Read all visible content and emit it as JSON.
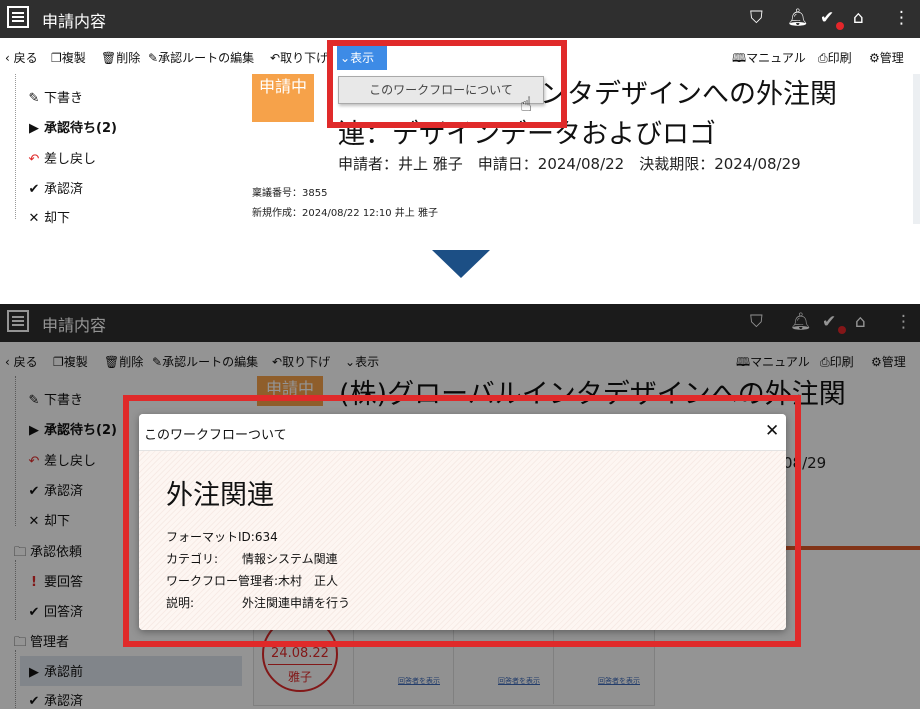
{
  "header": {
    "title": "申請内容",
    "icons": [
      "menu-icon",
      "beginner-mark-icon",
      "bell-icon",
      "check-icon",
      "home-icon",
      "more-vertical-icon"
    ]
  },
  "toolbar": {
    "back": "戻る",
    "duplicate": "複製",
    "delete": "削除",
    "route_edit": "承認ルートの編集",
    "withdraw": "取り下げ",
    "withdraw_short": "取り下げ",
    "display": "表示",
    "manual": "マニュアル",
    "print": "印刷",
    "admin": "管理"
  },
  "dropdown": {
    "item": "このワークフローについて"
  },
  "sidebar": {
    "draft": "下書き",
    "pending": "承認待ち(2)",
    "returned": "差し戻し",
    "approved": "承認済",
    "rejected": "却下",
    "request_group": "承認依頼",
    "needs_answer": "要回答",
    "answered": "回答済",
    "admin_group": "管理者",
    "before_approval": "承認前",
    "admin_approved": "承認済"
  },
  "document": {
    "status": "申請中",
    "title_line1": "(株)グローバルインタデザインへの外注関",
    "title_line2": "連：デザインデータおよびロゴ",
    "meta": "申請者：井上 雅子　申請日：2024/08/22　決裁期限：2024/08/29",
    "serial": "稟議番号：3855",
    "created": "新規作成：2024/08/22 12:10 井上 雅子",
    "deadline_partial": "08/29",
    "stamp_date": "24.08.22",
    "stamp_name": "雅子",
    "show_answerer": "回答者を表示"
  },
  "modal": {
    "header_title": "このワークフローついて",
    "heading": "外注関連",
    "format_id": "フォーマットID:634",
    "category_label": "カテゴリ:",
    "category_value": "情報システム関連",
    "manager": "ワークフロー管理者:木村　正人",
    "desc_label": "説明:",
    "desc_value": "外注関連申請を行う"
  },
  "colors": {
    "topbar": "#2f2f2f",
    "highlight": "#e02a2a",
    "accent_blue": "#3d8be6",
    "badge": "#f6a24a",
    "arrow": "#1c4f85"
  }
}
